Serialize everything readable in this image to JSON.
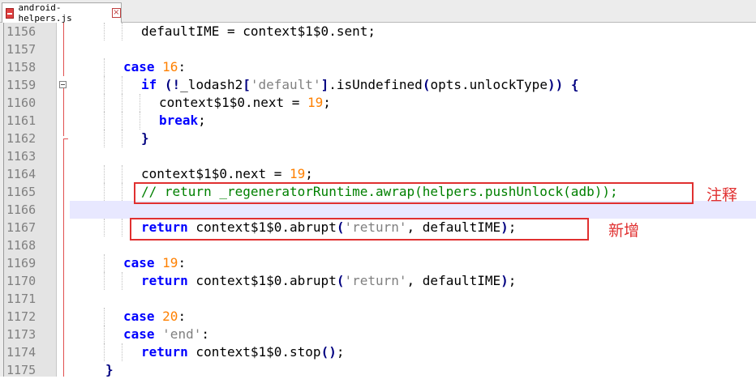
{
  "tab": {
    "title": "android-helpers.js",
    "close_glyph": "×",
    "icon": "file-red-icon"
  },
  "colors": {
    "keyword": "#0000ff",
    "number": "#ff8000",
    "string": "#808080",
    "comment": "#008000",
    "annotation": "#e03030"
  },
  "lines": [
    {
      "num": "1156",
      "indent": 4,
      "tokens": [
        [
          "plain",
          "defaultIME = context$1$0.sent;"
        ]
      ]
    },
    {
      "num": "1157",
      "indent": 0,
      "tokens": []
    },
    {
      "num": "1158",
      "indent": 3,
      "tokens": [
        [
          "kw",
          "case"
        ],
        [
          "plain",
          " "
        ],
        [
          "num",
          "16"
        ],
        [
          "plain",
          ":"
        ]
      ]
    },
    {
      "num": "1159",
      "indent": 4,
      "tokens": [
        [
          "kw",
          "if"
        ],
        [
          "plain",
          " "
        ],
        [
          "op",
          "(!"
        ],
        [
          "plain",
          "_lodash2"
        ],
        [
          "op",
          "["
        ],
        [
          "str",
          "'default'"
        ],
        [
          "op",
          "]"
        ],
        [
          "plain",
          ".isUndefined"
        ],
        [
          "op",
          "("
        ],
        [
          "plain",
          "opts.unlockType"
        ],
        [
          "op",
          "))"
        ],
        [
          "plain",
          " "
        ],
        [
          "op",
          "{"
        ]
      ]
    },
    {
      "num": "1160",
      "indent": 5,
      "tokens": [
        [
          "plain",
          "context$1$0.next = "
        ],
        [
          "num",
          "19"
        ],
        [
          "plain",
          ";"
        ]
      ]
    },
    {
      "num": "1161",
      "indent": 5,
      "tokens": [
        [
          "kw",
          "break"
        ],
        [
          "plain",
          ";"
        ]
      ]
    },
    {
      "num": "1162",
      "indent": 4,
      "tokens": [
        [
          "op",
          "}"
        ]
      ]
    },
    {
      "num": "1163",
      "indent": 0,
      "tokens": []
    },
    {
      "num": "1164",
      "indent": 4,
      "tokens": [
        [
          "plain",
          "context$1$0.next = "
        ],
        [
          "num",
          "19"
        ],
        [
          "plain",
          ";"
        ]
      ]
    },
    {
      "num": "1165",
      "indent": 4,
      "tokens": [
        [
          "cmt",
          "// return _regeneratorRuntime.awrap(helpers.pushUnlock(adb));"
        ]
      ]
    },
    {
      "num": "1166",
      "indent": 0,
      "tokens": []
    },
    {
      "num": "1167",
      "indent": 4,
      "tokens": [
        [
          "kw",
          "return"
        ],
        [
          "plain",
          " context$1$0.abrupt"
        ],
        [
          "op",
          "("
        ],
        [
          "str",
          "'return'"
        ],
        [
          "plain",
          ", defaultIME"
        ],
        [
          "op",
          ")"
        ],
        [
          "plain",
          ";"
        ]
      ]
    },
    {
      "num": "1168",
      "indent": 0,
      "tokens": []
    },
    {
      "num": "1169",
      "indent": 3,
      "tokens": [
        [
          "kw",
          "case"
        ],
        [
          "plain",
          " "
        ],
        [
          "num",
          "19"
        ],
        [
          "plain",
          ":"
        ]
      ]
    },
    {
      "num": "1170",
      "indent": 4,
      "tokens": [
        [
          "kw",
          "return"
        ],
        [
          "plain",
          " context$1$0.abrupt"
        ],
        [
          "op",
          "("
        ],
        [
          "str",
          "'return'"
        ],
        [
          "plain",
          ", defaultIME"
        ],
        [
          "op",
          ")"
        ],
        [
          "plain",
          ";"
        ]
      ]
    },
    {
      "num": "1171",
      "indent": 0,
      "tokens": []
    },
    {
      "num": "1172",
      "indent": 3,
      "tokens": [
        [
          "kw",
          "case"
        ],
        [
          "plain",
          " "
        ],
        [
          "num",
          "20"
        ],
        [
          "plain",
          ":"
        ]
      ]
    },
    {
      "num": "1173",
      "indent": 3,
      "tokens": [
        [
          "kw",
          "case"
        ],
        [
          "plain",
          " "
        ],
        [
          "str",
          "'end'"
        ],
        [
          "plain",
          ":"
        ]
      ]
    },
    {
      "num": "1174",
      "indent": 4,
      "tokens": [
        [
          "kw",
          "return"
        ],
        [
          "plain",
          " context$1$0.stop"
        ],
        [
          "op",
          "()"
        ],
        [
          "plain",
          ";"
        ]
      ]
    },
    {
      "num": "1175",
      "indent": 2,
      "tokens": [
        [
          "op",
          "}"
        ]
      ]
    }
  ],
  "annotations": {
    "comment_label": "注释",
    "added_label": "新增"
  }
}
